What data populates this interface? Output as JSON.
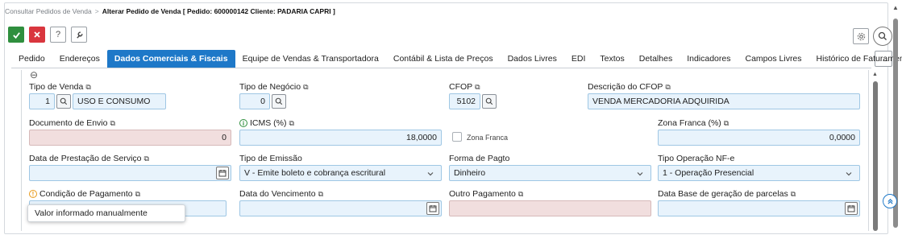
{
  "breadcrumb": {
    "parent": "Consultar Pedidos de Venda",
    "separator": ">",
    "current": "Alterar Pedido de Venda [ Pedido: 600000142 Cliente: PADARIA CAPRI ]"
  },
  "toolbar": {
    "confirm_icon": "check-icon",
    "cancel_icon": "close-icon",
    "help_label": "?",
    "tool_icon": "wrench-icon",
    "settings_icon": "gear-icon",
    "search_icon": "search-icon",
    "more_label": "..."
  },
  "tabs": [
    {
      "label": "Pedido"
    },
    {
      "label": "Endereços"
    },
    {
      "label": "Dados Comerciais & Fiscais",
      "active": true
    },
    {
      "label": "Equipe de Vendas & Transportadora"
    },
    {
      "label": "Contábil & Lista de Preços"
    },
    {
      "label": "Dados Livres"
    },
    {
      "label": "EDI"
    },
    {
      "label": "Textos"
    },
    {
      "label": "Detalhes"
    },
    {
      "label": "Indicadores"
    },
    {
      "label": "Campos Livres"
    },
    {
      "label": "Histórico de Faturamento"
    }
  ],
  "form": {
    "tipo_venda": {
      "label": "Tipo de Venda",
      "code": "1",
      "value": "USO E CONSUMO"
    },
    "tipo_negocio": {
      "label": "Tipo de Negócio",
      "code": "0"
    },
    "cfop": {
      "label": "CFOP",
      "code": "5102"
    },
    "descricao_cfop": {
      "label": "Descrição do CFOP",
      "value": "VENDA MERCADORIA ADQUIRIDA"
    },
    "documento_envio": {
      "label": "Documento de Envio",
      "value": "0"
    },
    "icms": {
      "label": "ICMS (%)",
      "value": "18,0000"
    },
    "zona_franca_check": {
      "label": "Zona Franca"
    },
    "zona_franca_pct": {
      "label": "Zona Franca (%)",
      "value": "0,0000"
    },
    "data_prestacao": {
      "label": "Data de Prestação de Serviço",
      "value": ""
    },
    "tipo_emissao": {
      "label": "Tipo de Emissão",
      "value": "V - Emite boleto e cobrança escritural"
    },
    "forma_pagto": {
      "label": "Forma de Pagto",
      "value": "Dinheiro"
    },
    "tipo_operacao": {
      "label": "Tipo Operação NF-e",
      "value": "1 - Operação Presencial"
    },
    "condicao_pagamento": {
      "label": "Condição de Pagamento",
      "value": ""
    },
    "data_vencimento": {
      "label": "Data do Vencimento",
      "value": ""
    },
    "outro_pagamento": {
      "label": "Outro Pagamento",
      "value": ""
    },
    "data_base": {
      "label": "Data Base de geração de parcelas",
      "value": ""
    }
  },
  "tooltip": {
    "text": "Valor informado manualmente"
  },
  "colors": {
    "accent": "#1e78c8",
    "confirm": "#2f8f3e",
    "cancel": "#d9363e",
    "field_bg": "#e8f3fc",
    "disabled_bg": "#f1dede"
  }
}
